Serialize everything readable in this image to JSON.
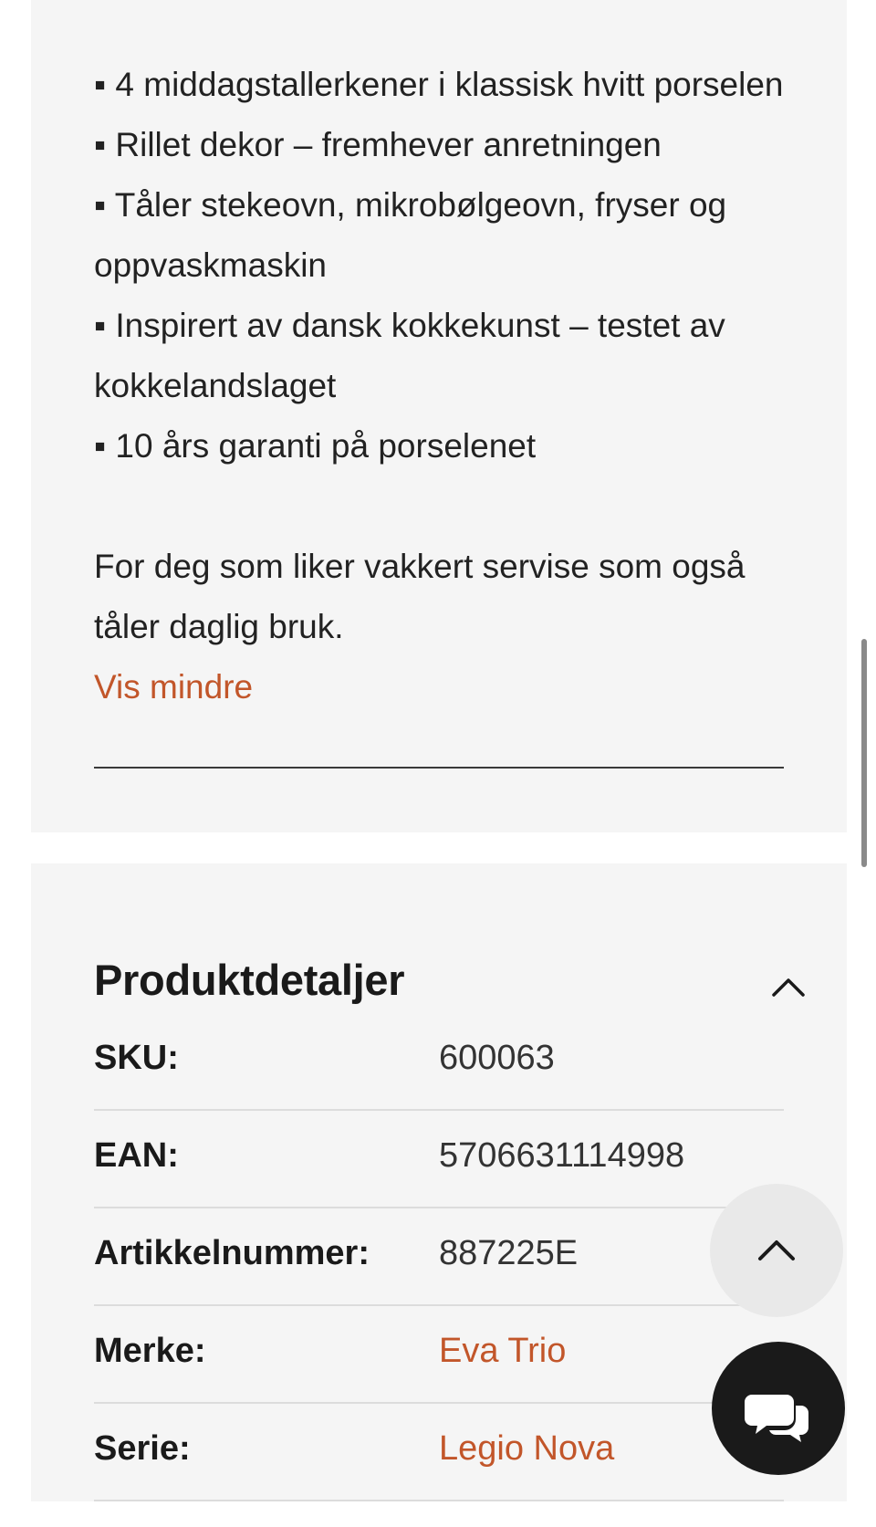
{
  "description": {
    "bullets": [
      "▪ 4 middagstallerkener i klassisk hvitt porselen",
      "▪ Rillet dekor – fremhever anretningen",
      "▪ Tåler stekeovn, mikrobølgeovn, fryser og oppvaskmaskin",
      "▪ Inspirert av dansk kokkekunst – testet av kokkelandslaget",
      "▪ 10 års garanti på porselenet"
    ],
    "summary": "For deg som liker vakkert servise som også tåler daglig bruk.",
    "show_less_label": "Vis mindre"
  },
  "product_details": {
    "title": "Produktdetaljer",
    "toggle_icon": "chevron-up-icon",
    "rows": [
      {
        "label": "SKU:",
        "value": "600063"
      },
      {
        "label": "EAN:",
        "value": "5706631114998"
      },
      {
        "label": "Artikkelnummer:",
        "value": "887225E"
      },
      {
        "label": "Merke:",
        "value": "Eva Trio"
      },
      {
        "label": "Serie:",
        "value": "Legio Nova"
      }
    ]
  },
  "floating_buttons": {
    "scroll_top_icon": "chevron-up-icon",
    "chat_icon": "chat-bubbles-icon"
  },
  "colors": {
    "accent_link": "#c2562a",
    "card_background": "#f5f5f5",
    "chat_button": "#1a1a1a",
    "scroll_top_button": "#e9e9e9"
  }
}
